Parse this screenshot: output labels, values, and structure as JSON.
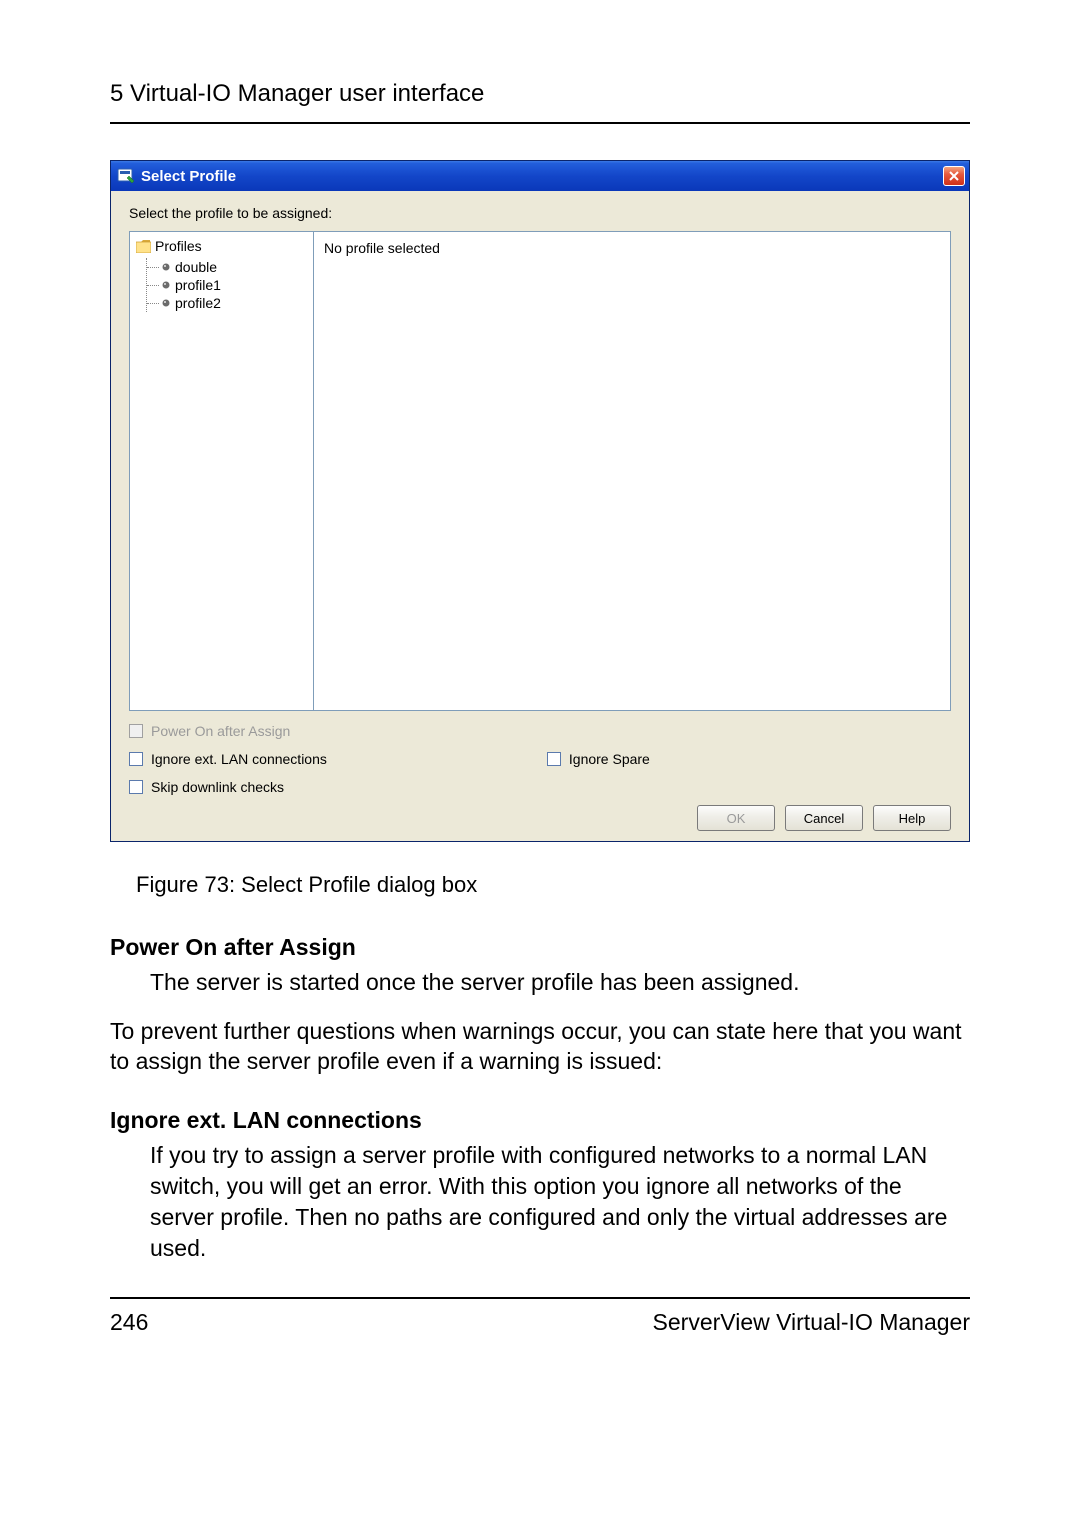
{
  "header": "5 Virtual-IO Manager user interface",
  "dialog": {
    "title": "Select Profile",
    "instruction": "Select the profile to be assigned:",
    "tree_root": "Profiles",
    "profiles": [
      "double",
      "profile1",
      "profile2"
    ],
    "detail_text": "No profile selected",
    "checkboxes": {
      "power_on": "Power On after Assign",
      "ignore_lan": "Ignore ext. LAN connections",
      "ignore_spare": "Ignore Spare",
      "skip_downlink": "Skip downlink checks"
    },
    "buttons": {
      "ok": "OK",
      "cancel": "Cancel",
      "help": "Help"
    }
  },
  "figure_caption": "Figure 73: Select Profile dialog box",
  "sections": {
    "power_on_title": "Power On after Assign",
    "power_on_text": "The server is started once the server profile has been assigned.",
    "intermediate": "To prevent further questions when warnings occur, you can state here that you want to assign the server profile even if a warning is issued:",
    "ignore_lan_title": "Ignore ext. LAN connections",
    "ignore_lan_text": "If you try to assign a server profile with configured networks to a normal LAN switch, you will get an error. With this option you ignore all networks of the server profile. Then no paths are configured and only the virtual addresses are used."
  },
  "footer": {
    "page": "246",
    "product": "ServerView Virtual-IO Manager"
  }
}
